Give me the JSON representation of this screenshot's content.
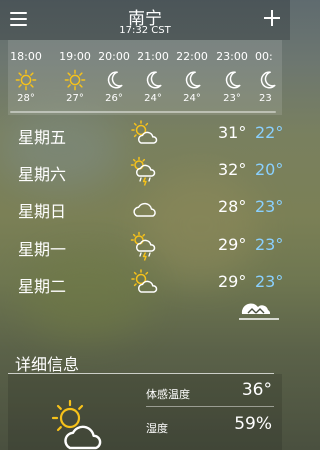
{
  "header": {
    "city": "南宁",
    "time": "17:32 CST",
    "menu_icon": "menu-icon",
    "add_icon": "add-icon"
  },
  "hourly": [
    {
      "time": "18:00",
      "icon": "sun-icon",
      "temp": "28°"
    },
    {
      "time": "19:00",
      "icon": "sun-icon",
      "temp": "27°"
    },
    {
      "time": "20:00",
      "icon": "moon-icon",
      "temp": "26°"
    },
    {
      "time": "21:00",
      "icon": "moon-icon",
      "temp": "24°"
    },
    {
      "time": "22:00",
      "icon": "moon-icon",
      "temp": "24°"
    },
    {
      "time": "23:00",
      "icon": "moon-icon",
      "temp": "23°"
    },
    {
      "time": "00:",
      "icon": "moon-icon",
      "temp": "23"
    }
  ],
  "daily": [
    {
      "day": "星期五",
      "icon": "sun-cloud-icon",
      "high": "31°",
      "low": "22°"
    },
    {
      "day": "星期六",
      "icon": "sun-storm-icon",
      "high": "32°",
      "low": "20°"
    },
    {
      "day": "星期日",
      "icon": "cloud-icon",
      "high": "28°",
      "low": "23°"
    },
    {
      "day": "星期一",
      "icon": "sun-storm-icon",
      "high": "29°",
      "low": "23°"
    },
    {
      "day": "星期二",
      "icon": "sun-cloud-icon",
      "high": "29°",
      "low": "23°"
    }
  ],
  "details": {
    "title": "详细信息",
    "feels_like_label": "体感温度",
    "feels_like_value": "36°",
    "humidity_label": "湿度",
    "humidity_value": "59%",
    "big_icon": "sun-cloud-icon"
  },
  "colors": {
    "low_temp": "#8ad0ff",
    "sun": "#f7c21a"
  }
}
